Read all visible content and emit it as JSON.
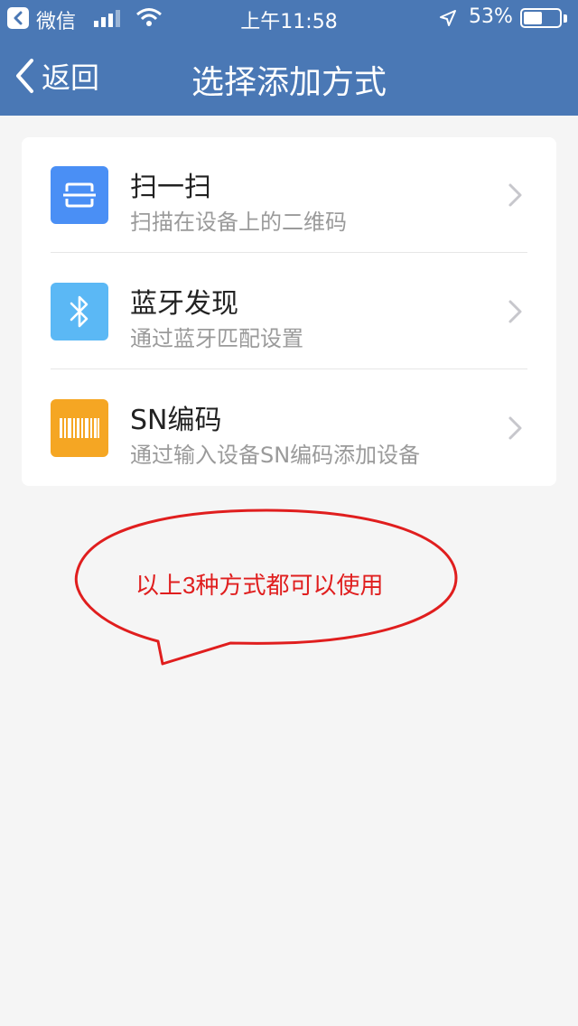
{
  "status_bar": {
    "back_app": "微信",
    "time": "上午11:58",
    "battery": "53%",
    "battery_level": 0.53,
    "icons": [
      "back-to-app-icon",
      "signal-icon",
      "wifi-icon",
      "location-icon",
      "battery-icon"
    ]
  },
  "nav": {
    "back_label": "返回",
    "title": "选择添加方式"
  },
  "options": [
    {
      "title": "扫一扫",
      "subtitle": "扫描在设备上的二维码",
      "icon": "scan-icon",
      "color": "#4a8ff5"
    },
    {
      "title": "蓝牙发现",
      "subtitle": "通过蓝牙匹配设置",
      "icon": "bluetooth-icon",
      "color": "#5bb8f5"
    },
    {
      "title": "SN编码",
      "subtitle": "通过输入设备SN编码添加设备",
      "icon": "barcode-icon",
      "color": "#f5a623"
    }
  ],
  "annotation": {
    "text": "以上3种方式都可以使用",
    "color": "#e01e1e"
  },
  "colors": {
    "header": "#4a78b5",
    "background": "#f5f5f5"
  }
}
